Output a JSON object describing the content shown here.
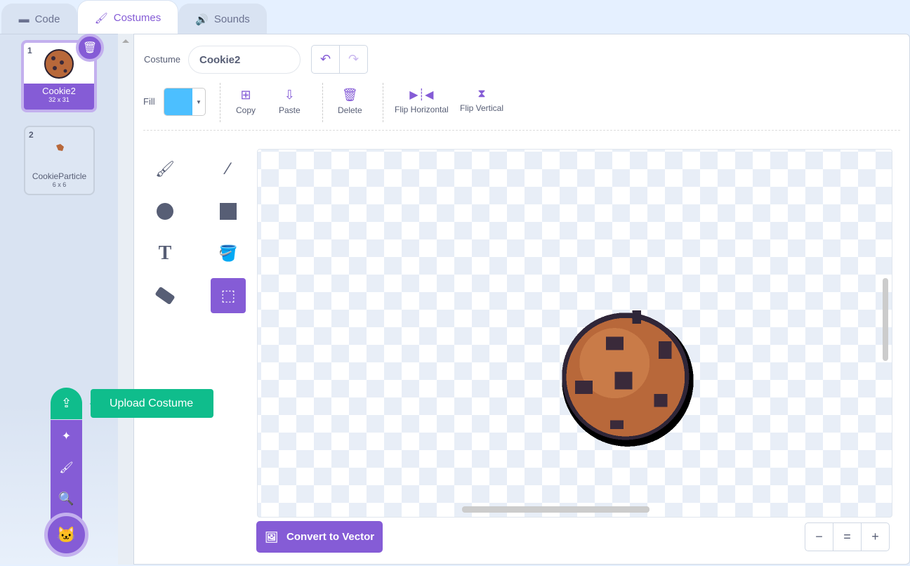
{
  "tabs": [
    {
      "label": "Code",
      "icon": "code-icon"
    },
    {
      "label": "Costumes",
      "icon": "brush-icon",
      "active": true
    },
    {
      "label": "Sounds",
      "icon": "speaker-icon"
    }
  ],
  "costumes": [
    {
      "index": "1",
      "name": "Cookie2",
      "size": "32 x 31",
      "selected": true
    },
    {
      "index": "2",
      "name": "CookieParticle",
      "size": "6 x 6"
    }
  ],
  "editor": {
    "costume_label": "Costume",
    "costume_name": "Cookie2",
    "fill_label": "Fill",
    "fill_color": "#4cbfff",
    "actions": {
      "copy": "Copy",
      "paste": "Paste",
      "delete": "Delete",
      "flip_h": "Flip Horizontal",
      "flip_v": "Flip Vertical"
    },
    "convert_label": "Convert to Vector",
    "zoom": {
      "out": "−",
      "reset": "=",
      "in": "+"
    }
  },
  "tools": [
    "brush",
    "line",
    "circle",
    "rectangle",
    "text",
    "fill",
    "eraser",
    "select"
  ],
  "selected_tool": "select",
  "upload_tooltip": "Upload Costume",
  "colors": {
    "accent": "#855cd6",
    "upload": "#0fbd8c"
  }
}
